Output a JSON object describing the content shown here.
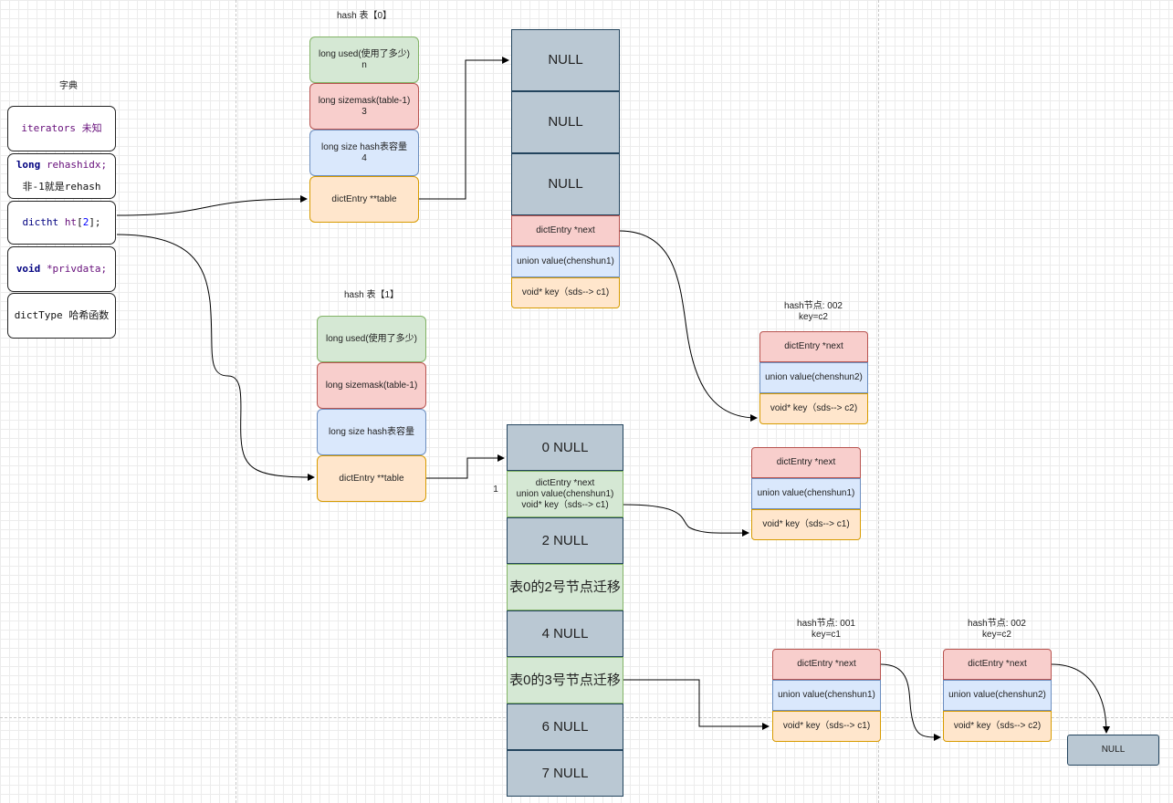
{
  "dict": {
    "title": "字典",
    "iterators_code": "iterators",
    "iterators_note": "未知",
    "rehashidx_type": "long",
    "rehashidx_name": "rehashidx;",
    "rehashidx_note": "非-1就是rehash",
    "ht_type": "dictht",
    "ht_name": "ht",
    "ht_open": "[",
    "ht_num": "2",
    "ht_close": "];",
    "privdata_type": "void",
    "privdata_name": "*privdata;",
    "dicttype_label": "dictType 哈希函数"
  },
  "ht0": {
    "title": "hash 表【0】",
    "used_line1": "long used(使用了多少)",
    "used_line2": "n",
    "sizemask_line1": "long sizemask(table-1)",
    "sizemask_line2": "3",
    "size_line1": "long size hash表容量",
    "size_line2": "4",
    "table": "dictEntry **table"
  },
  "ht1": {
    "title": "hash 表【1】",
    "used": "long used(使用了多少)",
    "sizemask": "long sizemask(table-1)",
    "size": "long size hash表容量",
    "table": "dictEntry **table"
  },
  "table0": {
    "slots": [
      "NULL",
      "NULL",
      "NULL"
    ],
    "entry": {
      "next": "dictEntry *next",
      "value": "union value(chenshun1)",
      "key": "void* key（sds--> c1)"
    }
  },
  "node_c2_top": {
    "title_line1": "hash节点: 002",
    "title_line2": "key=c2",
    "next": "dictEntry *next",
    "value": "union value(chenshun2)",
    "key": "void* key（sds--> c2)"
  },
  "node_c1_mid": {
    "next": "dictEntry *next",
    "value": "union value(chenshun1)",
    "key": "void* key（sds--> c1)"
  },
  "table1": {
    "index_label": "1",
    "slot0": "0 NULL",
    "slot1_line1": "dictEntry *next",
    "slot1_line2": "union value(chenshun1)",
    "slot1_line3": "void* key（sds--> c1)",
    "slot2": "2 NULL",
    "slot3": "表0的2号节点迁移",
    "slot4": "4 NULL",
    "slot5": "表0的3号节点迁移",
    "slot6": "6 NULL",
    "slot7": "7 NULL"
  },
  "node_001": {
    "title_line1": "hash节点: 001",
    "title_line2": "key=c1",
    "next": "dictEntry *next",
    "value": "union value(chenshun1)",
    "key": "void* key（sds--> c1)"
  },
  "node_002": {
    "title_line1": "hash节点: 002",
    "title_line2": "key=c2",
    "next": "dictEntry *next",
    "value": "union value(chenshun2)",
    "key": "void* key（sds--> c2)"
  },
  "null_end": "NULL",
  "colors": {
    "green_fill": "#d5e8d4",
    "red_fill": "#f8cecc",
    "blue_fill": "#dae8fc",
    "orange_fill": "#ffe6cc",
    "gray_fill": "#bac8d3"
  }
}
